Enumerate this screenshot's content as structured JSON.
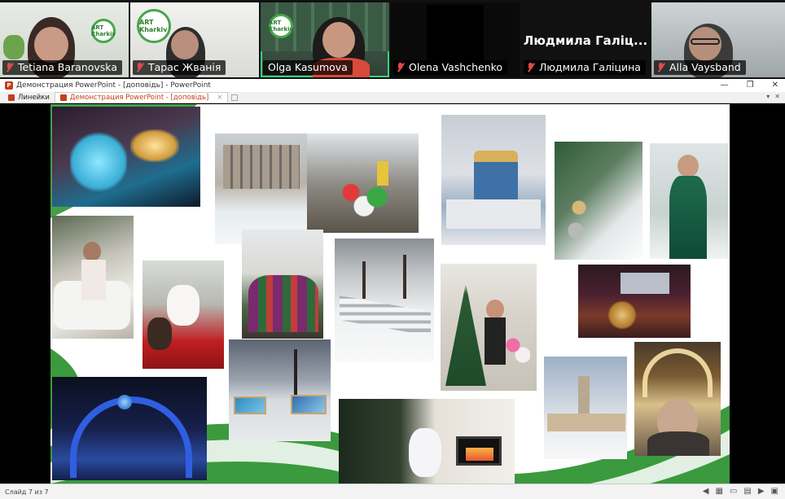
{
  "participants": [
    {
      "name": "Tetiana Baranovska",
      "muted": true
    },
    {
      "name": "Тарас Жванія",
      "muted": true
    },
    {
      "name": "Olga Kasumova",
      "muted": false,
      "active": true
    },
    {
      "name": "Olena Vashchenko",
      "muted": true
    },
    {
      "name": "Людмила Галіцина",
      "muted": true,
      "video_label": "Людмила  Галіц..."
    },
    {
      "name": "Alla Vaysband",
      "muted": true
    }
  ],
  "logos": {
    "left": "ART Kharkiv",
    "right": "ART Kharkiv"
  },
  "window": {
    "title": "Демонстрация PowerPoint - [доповідь] - PowerPoint",
    "controls": {
      "minimize": "—",
      "restore": "❐",
      "close": "✕"
    }
  },
  "tabs": [
    {
      "label": "Линейки"
    },
    {
      "label": "Демонстрация PowerPoint - [доповідь]",
      "close": "×"
    }
  ],
  "statusbar": {
    "slide_counter": "Слайд 7 из 7",
    "tool_icons": [
      "◀",
      "▦",
      "▭",
      "▤",
      "▶",
      "▣"
    ]
  },
  "colors": {
    "active_border": "#3fd07a",
    "mute_red": "#e14b4b",
    "ppt_orange": "#c43e1c",
    "slide_green": "#3b9a3e"
  },
  "slide_photos": [
    {
      "name": "photo-ice-sculpture-night"
    },
    {
      "name": "photo-apartment-winter"
    },
    {
      "name": "photo-candy-decorations"
    },
    {
      "name": "photo-cathedral-winter"
    },
    {
      "name": "photo-christmas-tree-closeup"
    },
    {
      "name": "photo-woman-green-dress"
    },
    {
      "name": "photo-woman-white-sofa"
    },
    {
      "name": "photo-santa-claus"
    },
    {
      "name": "photo-group-costumes"
    },
    {
      "name": "photo-snowy-bench"
    },
    {
      "name": "photo-woman-christmas-tree"
    },
    {
      "name": "photo-palace-lights"
    },
    {
      "name": "photo-arch-lights"
    },
    {
      "name": "photo-street-lamp-paintings"
    },
    {
      "name": "photo-woman-fireplace"
    },
    {
      "name": "photo-tower-winter"
    },
    {
      "name": "photo-woman-light-arch"
    }
  ]
}
